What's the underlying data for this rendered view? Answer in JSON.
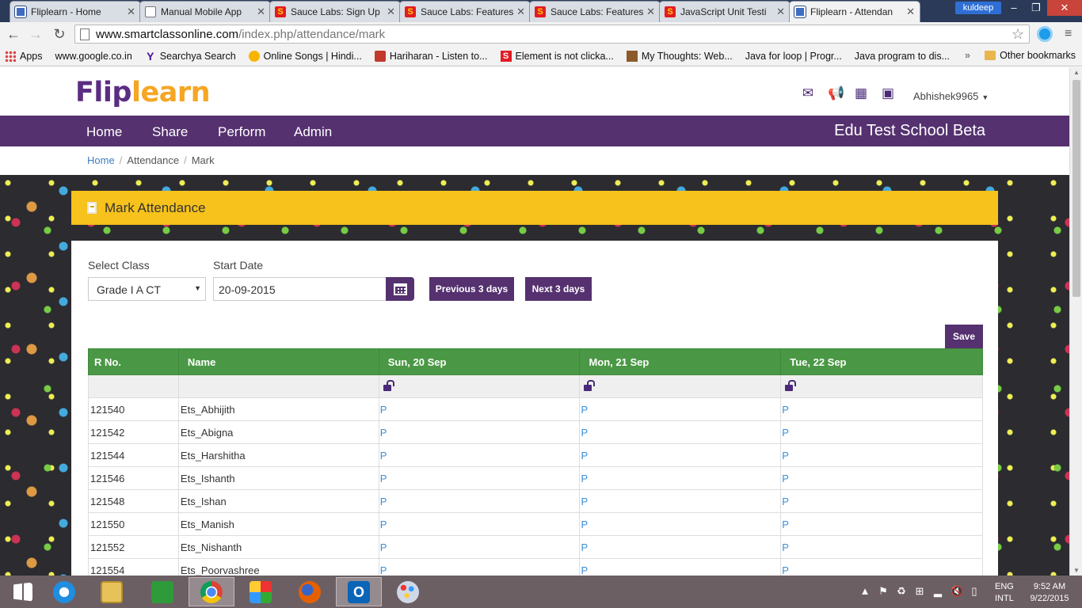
{
  "browser": {
    "tabs": [
      {
        "title": "Fliplearn - Home",
        "favicon": "fliplearn",
        "active": false
      },
      {
        "title": "Manual Mobile App",
        "favicon": "doc",
        "active": false
      },
      {
        "title": "Sauce Labs: Sign Up",
        "favicon": "sauce",
        "active": false
      },
      {
        "title": "Sauce Labs: Features",
        "favicon": "sauce",
        "active": false
      },
      {
        "title": "Sauce Labs: Features",
        "favicon": "sauce",
        "active": false
      },
      {
        "title": "JavaScript Unit Testi",
        "favicon": "sauce",
        "active": false
      },
      {
        "title": "Fliplearn - Attendan",
        "favicon": "fliplearn",
        "active": true
      }
    ],
    "profile_name": "kuldeep",
    "url_host": "www.smartclassonline.com",
    "url_path": "/index.php/attendance/mark",
    "bookmarks": [
      {
        "label": "Apps",
        "icon": "apps"
      },
      {
        "label": "www.google.co.in",
        "icon": "page"
      },
      {
        "label": "Searchya Search",
        "icon": "yahoo"
      },
      {
        "label": "Online Songs | Hindi...",
        "icon": "song"
      },
      {
        "label": "Hariharan - Listen to...",
        "icon": "hari"
      },
      {
        "label": "Element is not clicka...",
        "icon": "sred"
      },
      {
        "label": "My Thoughts: Web...",
        "icon": "mythoughts"
      },
      {
        "label": "Java for loop | Progr...",
        "icon": "page"
      },
      {
        "label": "Java program to dis...",
        "icon": "page"
      }
    ],
    "bookmarks_more": "»",
    "other_bookmarks": "Other bookmarks"
  },
  "app": {
    "logo_part1": "Flip",
    "logo_part2": "learn",
    "header_icons": [
      "mail-icon",
      "megaphone-icon",
      "calendar-icon",
      "gallery-icon"
    ],
    "username": "Abhishek9965",
    "nav": [
      "Home",
      "Share",
      "Perform",
      "Admin"
    ],
    "school_name": "Edu Test School Beta",
    "breadcrumb": {
      "home": "Home",
      "section": "Attendance",
      "current": "Mark"
    },
    "panel_title": "Mark Attendance",
    "select_class_label": "Select Class",
    "select_class_value": "Grade I A CT",
    "start_date_label": "Start Date",
    "start_date_value": "20-09-2015",
    "prev_button": "Previous 3 days",
    "next_button": "Next 3 days",
    "save_button": "Save",
    "table": {
      "headers": [
        "R No.",
        "Name",
        "Sun, 20 Sep",
        "Mon, 21 Sep",
        "Tue, 22 Sep"
      ],
      "rows": [
        {
          "rno": "121540",
          "name": "Ets_Abhijith",
          "d1": "P",
          "d2": "P",
          "d3": "P"
        },
        {
          "rno": "121542",
          "name": "Ets_Abigna",
          "d1": "P",
          "d2": "P",
          "d3": "P"
        },
        {
          "rno": "121544",
          "name": "Ets_Harshitha",
          "d1": "P",
          "d2": "P",
          "d3": "P"
        },
        {
          "rno": "121546",
          "name": "Ets_Ishanth",
          "d1": "P",
          "d2": "P",
          "d3": "P"
        },
        {
          "rno": "121548",
          "name": "Ets_Ishan",
          "d1": "P",
          "d2": "P",
          "d3": "P"
        },
        {
          "rno": "121550",
          "name": "Ets_Manish",
          "d1": "P",
          "d2": "P",
          "d3": "P"
        },
        {
          "rno": "121552",
          "name": "Ets_Nishanth",
          "d1": "P",
          "d2": "P",
          "d3": "P"
        },
        {
          "rno": "121554",
          "name": "Ets_Poorvashree",
          "d1": "P",
          "d2": "P",
          "d3": "P"
        }
      ]
    },
    "colors": {
      "brand_purple": "#553170",
      "accent_yellow": "#f6c21b",
      "table_green": "#4a9845",
      "link_blue": "#3b7ec0"
    }
  },
  "taskbar": {
    "apps": [
      "windows-start",
      "internet-explorer",
      "file-explorer",
      "store",
      "chrome",
      "apps-grid",
      "firefox",
      "outlook",
      "paint"
    ],
    "lang_line1": "ENG",
    "lang_line2": "INTL",
    "time": "9:52 AM",
    "date": "9/22/2015"
  }
}
